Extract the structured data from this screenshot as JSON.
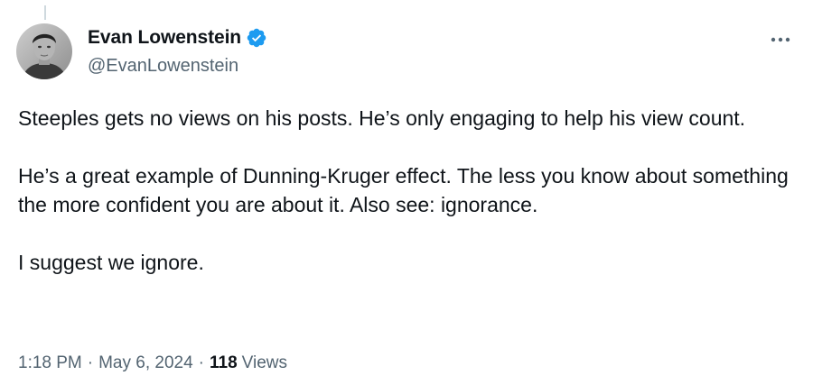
{
  "author": {
    "display_name": "Evan Lowenstein",
    "handle": "@EvanLowenstein",
    "verified": true
  },
  "icons": {
    "verified": "verified-badge-icon",
    "more": "more-horizontal-icon"
  },
  "tweet": {
    "paragraphs": [
      "Steeples gets no views on his posts. He’s only engaging to help his view count.",
      "He’s a great example of Dunning-Kruger effect. The less you know about something the more confident you are about it. Also see: ignorance.",
      "I suggest we ignore."
    ]
  },
  "meta": {
    "time": "1:18 PM",
    "separator": "·",
    "date": "May 6, 2024",
    "views_count": "118",
    "views_label": "Views"
  },
  "colors": {
    "text": "#0f1419",
    "secondary": "#536471",
    "verified": "#1d9bf0"
  }
}
